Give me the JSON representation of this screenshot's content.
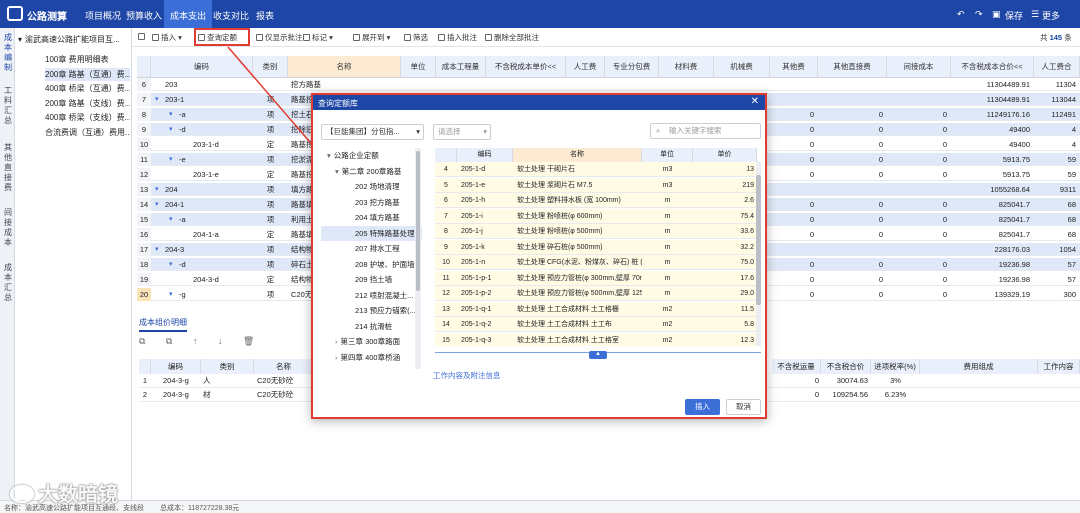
{
  "app": {
    "title": "公路测算",
    "menu": [
      "项目概况",
      "预算收入",
      "成本支出",
      "收支对比",
      "报表"
    ],
    "active_menu": "成本支出",
    "right_tools": [
      "↶",
      "↷",
      "▣",
      "保存",
      "☰",
      "更多"
    ]
  },
  "leftnav": [
    "成本编制",
    "工料汇总",
    "其他直接费",
    "间接成本",
    "成本汇总"
  ],
  "tree": [
    {
      "label": "渝武高速公路扩能项目互...",
      "depth": 0,
      "sel": false
    },
    {
      "label": "100章 费用明细表",
      "depth": 1,
      "sel": false
    },
    {
      "label": "200章 路基（互通）费...",
      "depth": 1,
      "sel": true
    },
    {
      "label": "400章 桥梁（互通）费...",
      "depth": 1,
      "sel": false
    },
    {
      "label": "200章 路基（支线）费...",
      "depth": 1,
      "sel": false
    },
    {
      "label": "400章 桥梁（支线）费...",
      "depth": 1,
      "sel": false
    },
    {
      "label": "合流费调（互通）费用...",
      "depth": 1,
      "sel": false
    }
  ],
  "toolbar": {
    "items": [
      "插入",
      "查询定额",
      "仅显示批注",
      "标记",
      "展开到",
      "筛选",
      "插入批注",
      "删除全部批注"
    ],
    "count_label": "共",
    "count": "145",
    "count_unit": "条"
  },
  "grid": {
    "headers": [
      "编码",
      "类别",
      "名称",
      "单位",
      "成本工程量",
      "不含税成本单价<<",
      "人工费",
      "专业分包费",
      "材料费",
      "机械费",
      "其他费",
      "其他直接费",
      "间接成本",
      "不含税成本合价<<",
      "人工费合"
    ],
    "rows": [
      {
        "no": "6",
        "code": "203",
        "cat": "",
        "name": "挖方路基",
        "unit": "",
        "qty": "",
        "price": "",
        "c1": "",
        "c2": "",
        "c3": "",
        "c4": "",
        "c5": "",
        "c6": "",
        "c7": "",
        "total": "11304489.91",
        "last": "11304",
        "style": "plain",
        "indent": 1
      },
      {
        "no": "7",
        "code": "203-1",
        "cat": "项",
        "name": "路基挖方",
        "unit": "",
        "qty": "",
        "price": "",
        "c1": "",
        "c2": "",
        "c3": "",
        "c4": "",
        "c5": "",
        "c6": "",
        "c7": "",
        "total": "11304489.91",
        "last": "113044",
        "style": "blue",
        "indent": 1
      },
      {
        "no": "8",
        "code": "-a",
        "cat": "项",
        "name": "挖土石方",
        "unit": "",
        "qty": "",
        "price": "",
        "c1": "",
        "c2": "",
        "c3": "",
        "c4": "0",
        "c5": "0",
        "c6": "0",
        "c7": "0",
        "total": "11249176.16",
        "last": "112491",
        "style": "blue",
        "indent": 2
      },
      {
        "no": "9",
        "code": "-d",
        "cat": "项",
        "name": "挖除旧路",
        "unit": "",
        "qty": "",
        "price": "",
        "c1": "",
        "c2": "",
        "c3": "",
        "c4": "0",
        "c5": "0",
        "c6": "0",
        "c7": "0",
        "total": "49400",
        "last": "4",
        "style": "blue",
        "indent": 2
      },
      {
        "no": "10",
        "code": "203-1-d",
        "cat": "定",
        "name": "路基挖方",
        "unit": "",
        "qty": "",
        "price": "",
        "c1": "",
        "c2": "",
        "c3": "",
        "c4": "0",
        "c5": "0",
        "c6": "0",
        "c7": "0",
        "total": "49400",
        "last": "4",
        "style": "plain",
        "indent": 3
      },
      {
        "no": "11",
        "code": "-e",
        "cat": "项",
        "name": "挖淤泥",
        "unit": "",
        "qty": "",
        "price": "",
        "c1": "",
        "c2": "",
        "c3": "",
        "c4": "0",
        "c5": "0",
        "c6": "0",
        "c7": "0",
        "total": "5913.75",
        "last": "59",
        "style": "blue",
        "indent": 2
      },
      {
        "no": "12",
        "code": "203-1-e",
        "cat": "定",
        "name": "路基挖淤",
        "unit": "",
        "qty": "",
        "price": "",
        "c1": "",
        "c2": "",
        "c3": "",
        "c4": "0",
        "c5": "0",
        "c6": "0",
        "c7": "0",
        "total": "5913.75",
        "last": "59",
        "style": "plain",
        "indent": 3
      },
      {
        "no": "13",
        "code": "204",
        "cat": "项",
        "name": "填方路基",
        "unit": "",
        "qty": "",
        "price": "",
        "c1": "",
        "c2": "",
        "c3": "",
        "c4": "",
        "c5": "",
        "c6": "",
        "c7": "",
        "total": "1055268.64",
        "last": "9311",
        "style": "blue",
        "indent": 1
      },
      {
        "no": "14",
        "code": "204-1",
        "cat": "项",
        "name": "路基填筑",
        "unit": "",
        "qty": "",
        "price": "",
        "c1": "",
        "c2": "",
        "c3": "",
        "c4": "0",
        "c5": "0",
        "c6": "0",
        "c7": "0",
        "total": "825041.7",
        "last": "68",
        "style": "blue",
        "indent": 1
      },
      {
        "no": "15",
        "code": "-a",
        "cat": "项",
        "name": "利用土方",
        "unit": "",
        "qty": "",
        "price": "",
        "c1": "",
        "c2": "",
        "c3": "",
        "c4": "0",
        "c5": "0",
        "c6": "0",
        "c7": "0",
        "total": "825041.7",
        "last": "68",
        "style": "blue",
        "indent": 2
      },
      {
        "no": "16",
        "code": "204-1-a",
        "cat": "定",
        "name": "路基填筑",
        "unit": "",
        "qty": "",
        "price": "",
        "c1": "",
        "c2": "",
        "c3": "",
        "c4": "0",
        "c5": "0",
        "c6": "0",
        "c7": "0",
        "total": "825041.7",
        "last": "68",
        "style": "plain",
        "indent": 3
      },
      {
        "no": "17",
        "code": "204-3",
        "cat": "项",
        "name": "结构物台背",
        "unit": "",
        "qty": "",
        "price": "",
        "c1": "",
        "c2": "",
        "c3": "",
        "c4": "",
        "c5": "",
        "c6": "",
        "c7": "",
        "total": "228176.03",
        "last": "1054",
        "style": "blue",
        "indent": 1
      },
      {
        "no": "18",
        "code": "-d",
        "cat": "项",
        "name": "碎石土填",
        "unit": "",
        "qty": "",
        "price": "",
        "c1": "",
        "c2": "",
        "c3": "",
        "c4": "0",
        "c5": "0",
        "c6": "0",
        "c7": "0",
        "total": "19236.98",
        "last": "57",
        "style": "blue",
        "indent": 2
      },
      {
        "no": "19",
        "code": "204-3-d",
        "cat": "定",
        "name": "结构物台",
        "unit": "",
        "qty": "",
        "price": "",
        "c1": "",
        "c2": "",
        "c3": "",
        "c4": "0",
        "c5": "0",
        "c6": "0",
        "c7": "0",
        "total": "19236.98",
        "last": "57",
        "style": "plain",
        "indent": 3
      },
      {
        "no": "20",
        "code": "-g",
        "cat": "项",
        "name": "C20无砂砼",
        "unit": "",
        "qty": "",
        "price": "",
        "c1": "",
        "c2": "",
        "c3": "",
        "c4": "0",
        "c5": "0",
        "c6": "0",
        "c7": "0",
        "total": "139329.19",
        "last": "300",
        "style": "sel",
        "indent": 2
      }
    ]
  },
  "detail": {
    "tab": "成本组价明细",
    "tools": "⧉ ⧉ ↑ ↓ 🗑",
    "headers": [
      "编码",
      "类别",
      "名称"
    ],
    "headers_right": [
      "不含税运量",
      "不含税合价",
      "进项税率(%)",
      "费用组成",
      "工作内容"
    ],
    "rows": [
      {
        "no": "1",
        "code": "204-3-g",
        "cat": "人",
        "name": "C20无砂砼",
        "v1": "0",
        "v2": "30074.63",
        "v3": "3%"
      },
      {
        "no": "2",
        "code": "204-3-g",
        "cat": "材",
        "name": "C20无砂砼",
        "v1": "0",
        "v2": "109254.56",
        "v3": "6.23%"
      }
    ]
  },
  "dialog": {
    "title": "查询定额库",
    "close": "✕",
    "select1": "【巨能集团】分包指...",
    "select2": "请选择",
    "search_placeholder": "输入关键字搜索",
    "tree": [
      {
        "label": "公路企业定额",
        "depth": 0,
        "hl": false
      },
      {
        "label": "第二章 200章路基",
        "depth": 1,
        "hl": false
      },
      {
        "label": "202 场地清理",
        "depth": 2,
        "hl": false
      },
      {
        "label": "203 挖方路基",
        "depth": 2,
        "hl": false
      },
      {
        "label": "204 填方路基",
        "depth": 2,
        "hl": false
      },
      {
        "label": "205 特殊路基处理",
        "depth": 2,
        "hl": true
      },
      {
        "label": "207 排水工程",
        "depth": 2,
        "hl": false
      },
      {
        "label": "208 护坡、护面墙",
        "depth": 2,
        "hl": false
      },
      {
        "label": "209 挡土墙",
        "depth": 2,
        "hl": false
      },
      {
        "label": "212 喷射混凝土...",
        "depth": 2,
        "hl": false
      },
      {
        "label": "213 预应力锚索(...",
        "depth": 2,
        "hl": false
      },
      {
        "label": "214 抗滑桩",
        "depth": 2,
        "hl": false
      },
      {
        "label": "第三章 300章路面",
        "depth": 1,
        "hl": false
      },
      {
        "label": "第四章 400章桥涵",
        "depth": 1,
        "hl": false
      }
    ],
    "grid_headers": [
      "编码",
      "名称",
      "单位",
      "单价"
    ],
    "grid_rows": [
      {
        "no": "4",
        "code": "205-1-d",
        "name": "软土处理 干砌片石",
        "unit": "m3",
        "price": "13"
      },
      {
        "no": "5",
        "code": "205-1-e",
        "name": "软土处理 浆砌片石 M7.5",
        "unit": "m3",
        "price": "219"
      },
      {
        "no": "6",
        "code": "205-1-h",
        "name": "软土处理 塑料排水板 (宽 100mm)",
        "unit": "m",
        "price": "2.6"
      },
      {
        "no": "7",
        "code": "205-1-i",
        "name": "软土处理 粉喷桩(φ 600mm)",
        "unit": "m",
        "price": "75.4"
      },
      {
        "no": "8",
        "code": "205-1-j",
        "name": "软土处理 粉喷桩(φ 500mm)",
        "unit": "m",
        "price": "33.6"
      },
      {
        "no": "9",
        "code": "205-1-k",
        "name": "软土处理 碎石桩(φ 500mm)",
        "unit": "m",
        "price": "32.2"
      },
      {
        "no": "10",
        "code": "205-1-n",
        "name": "软土处理 CFG(水泥、粉煤灰、碎石) 桩 (φ50...",
        "unit": "m",
        "price": "75.0"
      },
      {
        "no": "11",
        "code": "205-1-p-1",
        "name": "软土处理 预应力管桩(φ 300mm,壁厚 70mm)",
        "unit": "m",
        "price": "17.6"
      },
      {
        "no": "12",
        "code": "205-1-p-2",
        "name": "软土处理 预应力管桩(φ 500mm,壁厚 125mm)",
        "unit": "m",
        "price": "29.0"
      },
      {
        "no": "13",
        "code": "205-1-q-1",
        "name": "软土处理 土工合成材料 土工格栅",
        "unit": "m2",
        "price": "11.5"
      },
      {
        "no": "14",
        "code": "205-1-q-2",
        "name": "软土处理 土工合成材料 土工布",
        "unit": "m2",
        "price": "5.8"
      },
      {
        "no": "15",
        "code": "205-1-q-3",
        "name": "软土处理 土工合成材料 土工格室",
        "unit": "m2",
        "price": "12.3"
      }
    ],
    "info_link": "工作内容及附注信息",
    "insert": "插入",
    "cancel": "取消"
  },
  "status": {
    "left": "名称：渝武高速公路扩能项目互通段、支线段",
    "total": "总成本：118727228.38元"
  },
  "watermark": "大数暗镜"
}
